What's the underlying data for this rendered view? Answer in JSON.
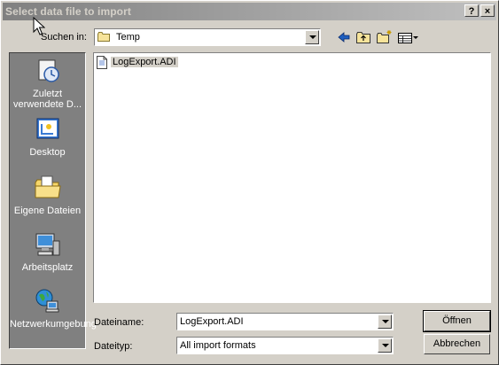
{
  "window": {
    "title": "Select data file to import",
    "help_label": "?",
    "close_label": "×"
  },
  "toolbar": {
    "look_in_label": "Suchen in:",
    "look_in_value": "Temp",
    "icons": [
      "back-arrow-icon",
      "up-folder-icon",
      "new-folder-icon",
      "view-menu-icon"
    ]
  },
  "places": [
    {
      "label": "Zuletzt verwendete D...",
      "icon": "recent-documents-icon"
    },
    {
      "label": "Desktop",
      "icon": "desktop-icon"
    },
    {
      "label": "Eigene Dateien",
      "icon": "my-documents-icon"
    },
    {
      "label": "Arbeitsplatz",
      "icon": "my-computer-icon"
    },
    {
      "label": "Netzwerkumgebung",
      "icon": "network-icon"
    }
  ],
  "files": [
    {
      "name": "LogExport.ADI",
      "icon": "document-icon"
    }
  ],
  "filename": {
    "label": "Dateiname:",
    "value": "LogExport.ADI"
  },
  "filetype": {
    "label": "Dateityp:",
    "value": "All import formats"
  },
  "buttons": {
    "open": "Öffnen",
    "cancel": "Abbrechen"
  },
  "colors": {
    "titlebar_start": "#808080",
    "titlebar_end": "#c0c0c0",
    "dialog_bg": "#d4d0c8",
    "places_bg": "#808080"
  }
}
